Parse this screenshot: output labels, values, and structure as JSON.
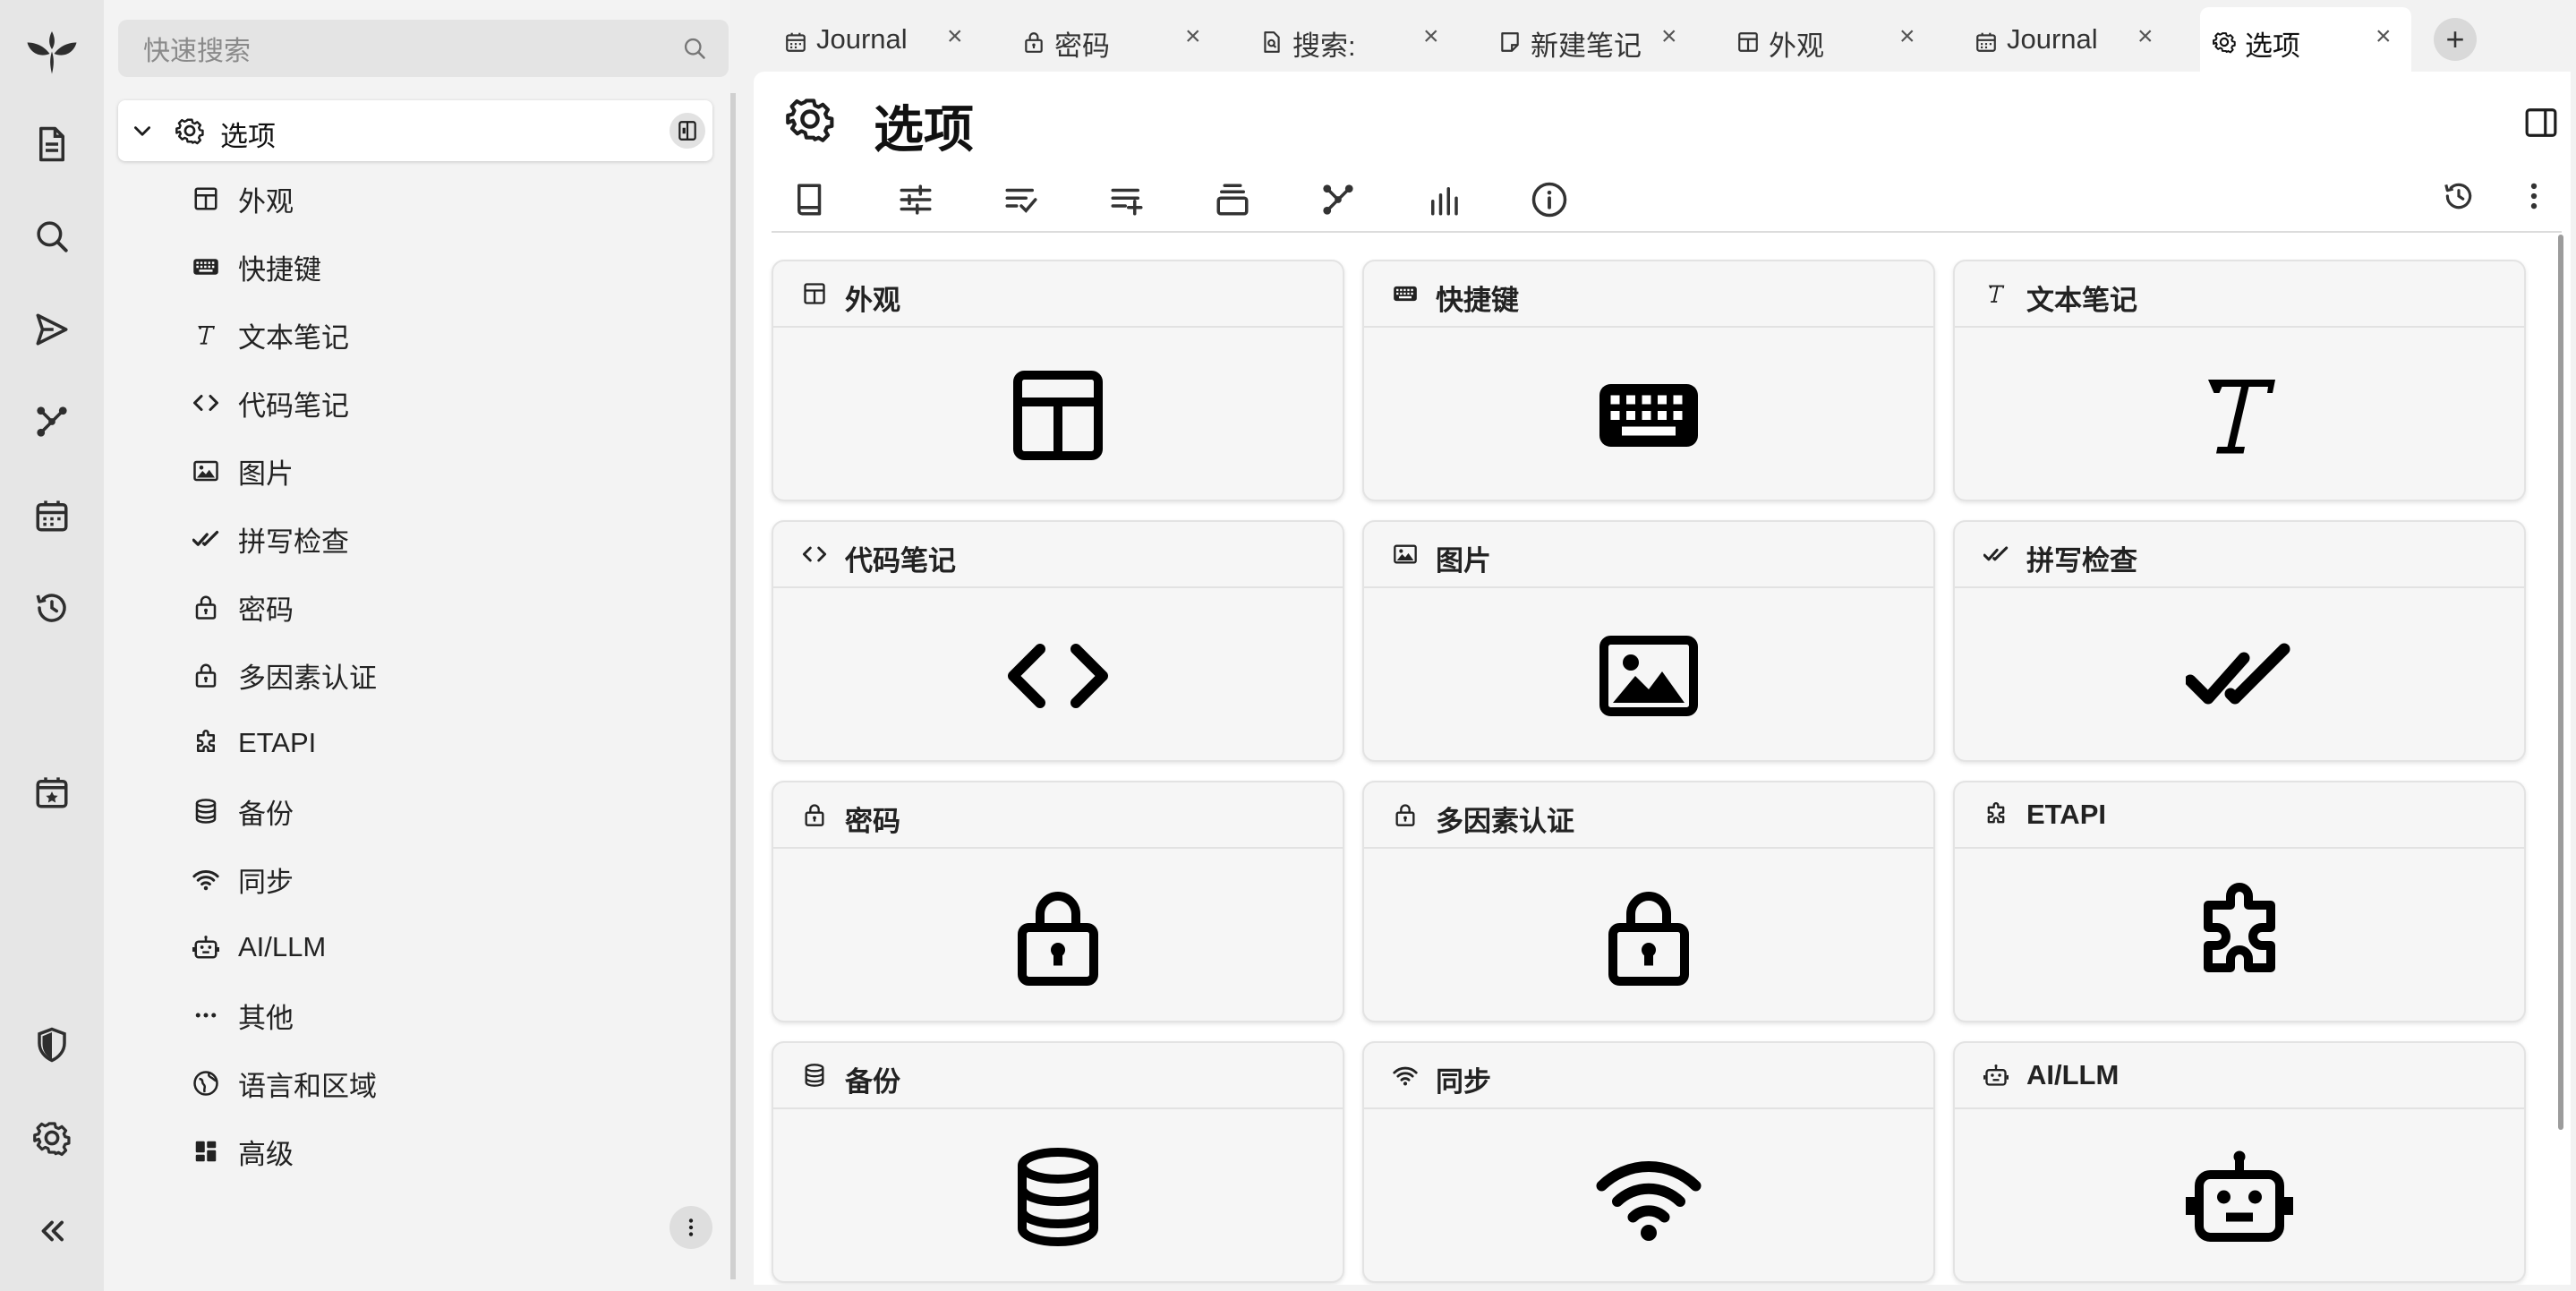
{
  "launcher": {
    "icons": [
      "app-logo-icon",
      "new-note-icon",
      "search-icon",
      "send-icon",
      "graph-icon",
      "calendar-icon",
      "history-icon",
      "today-calendar-icon",
      "shield-icon",
      "settings-icon",
      "collapse-icon"
    ]
  },
  "search": {
    "placeholder": "快速搜索"
  },
  "tree": {
    "root": {
      "label": "选项"
    },
    "items": [
      {
        "label": "外观",
        "icon": "layout-icon"
      },
      {
        "label": "快捷键",
        "icon": "keyboard-icon"
      },
      {
        "label": "文本笔记",
        "icon": "text-icon"
      },
      {
        "label": "代码笔记",
        "icon": "code-icon"
      },
      {
        "label": "图片",
        "icon": "image-icon"
      },
      {
        "label": "拼写检查",
        "icon": "checks-icon"
      },
      {
        "label": "密码",
        "icon": "lock-icon"
      },
      {
        "label": "多因素认证",
        "icon": "lock-icon"
      },
      {
        "label": "ETAPI",
        "icon": "puzzle-icon"
      },
      {
        "label": "备份",
        "icon": "database-icon"
      },
      {
        "label": "同步",
        "icon": "wifi-icon"
      },
      {
        "label": "AI/LLM",
        "icon": "robot-icon"
      },
      {
        "label": "其他",
        "icon": "dots-icon"
      },
      {
        "label": "语言和区域",
        "icon": "globe-icon"
      },
      {
        "label": "高级",
        "icon": "dashboard-icon"
      }
    ]
  },
  "tabs": [
    {
      "label": "Journal",
      "icon": "calendar-icon"
    },
    {
      "label": "密码",
      "icon": "lock-icon"
    },
    {
      "label": "搜索:",
      "icon": "search-file-icon"
    },
    {
      "label": "新建笔记",
      "icon": "note-icon"
    },
    {
      "label": "外观",
      "icon": "layout-icon"
    },
    {
      "label": "Journal",
      "icon": "calendar-icon"
    },
    {
      "label": "选项",
      "icon": "gear-icon",
      "active": true
    }
  ],
  "tab_close": "×",
  "new_tab": "+",
  "note": {
    "title": "选项"
  },
  "ribbon": [
    "book-icon",
    "sliders-icon",
    "list-check-icon",
    "list-plus-icon",
    "stack-icon",
    "graph-icon",
    "bar-chart-icon",
    "info-icon"
  ],
  "cards": [
    {
      "label": "外观",
      "icon": "layout-icon"
    },
    {
      "label": "快捷键",
      "icon": "keyboard-icon"
    },
    {
      "label": "文本笔记",
      "icon": "text-icon"
    },
    {
      "label": "代码笔记",
      "icon": "code-icon"
    },
    {
      "label": "图片",
      "icon": "image-icon"
    },
    {
      "label": "拼写检查",
      "icon": "checks-icon"
    },
    {
      "label": "密码",
      "icon": "lock-icon"
    },
    {
      "label": "多因素认证",
      "icon": "lock-icon"
    },
    {
      "label": "ETAPI",
      "icon": "puzzle-icon"
    },
    {
      "label": "备份",
      "icon": "database-icon"
    },
    {
      "label": "同步",
      "icon": "wifi-icon"
    },
    {
      "label": "AI/LLM",
      "icon": "robot-icon"
    }
  ]
}
